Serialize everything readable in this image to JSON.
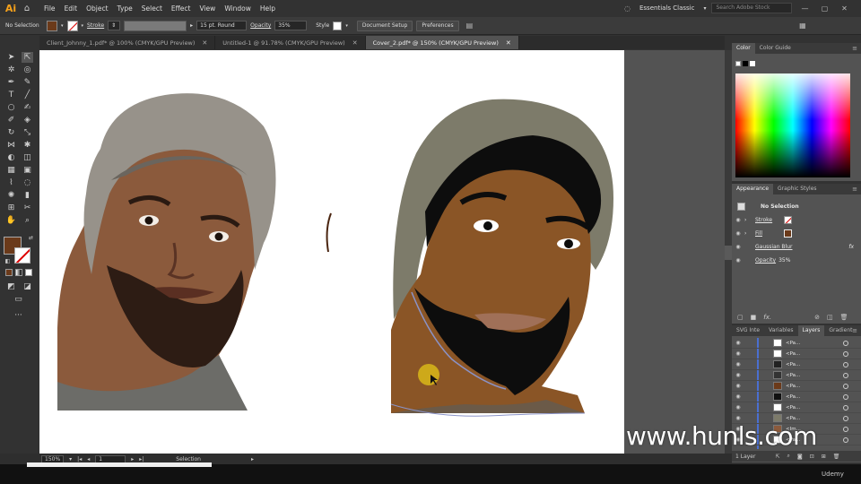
{
  "app": {
    "logo": "Ai",
    "home_icon": "home-icon"
  },
  "menu": [
    "File",
    "Edit",
    "Object",
    "Type",
    "Select",
    "Effect",
    "View",
    "Window",
    "Help"
  ],
  "workspace": "Essentials Classic",
  "search_placeholder": "Search Adobe Stock",
  "control": {
    "selection": "No Selection",
    "stroke_label": "Stroke",
    "brush": "15 pt. Round",
    "opacity_label": "Opacity",
    "opacity_value": "35%",
    "style_label": "Style",
    "doc_setup": "Document Setup",
    "preferences": "Preferences"
  },
  "tabs": [
    {
      "label": "Client_Johnny_1.pdf* @ 100% (CMYK/GPU Preview)",
      "active": false
    },
    {
      "label": "Untitled-1 @ 91.78% (CMYK/GPU Preview)",
      "active": false
    },
    {
      "label": "Cover_2.pdf* @ 150% (CMYK/GPU Preview)",
      "active": true
    }
  ],
  "color_panel": {
    "tabs": [
      "Color",
      "Color Guide"
    ]
  },
  "appearance_panel": {
    "tabs": [
      "Appearance",
      "Graphic Styles"
    ],
    "title": "No Selection",
    "rows": [
      {
        "label": "Stroke"
      },
      {
        "label": "Fill"
      },
      {
        "label": "Gaussian Blur",
        "fx": "fx"
      },
      {
        "label": "Opacity",
        "value": "35%"
      }
    ],
    "footer_fx": "fx."
  },
  "layers_panel": {
    "tabs": [
      "SVG Inte",
      "Variables",
      "Layers",
      "Gradient"
    ],
    "items": [
      "<Pa...",
      "<Pa...",
      "<Pa...",
      "<Pa...",
      "<Pa...",
      "<Pa...",
      "<Pa...",
      "<Pa...",
      "<Im...",
      "<Pa..."
    ],
    "footer": "1 Layer"
  },
  "status": {
    "zoom": "150%",
    "artboard": "1",
    "tool": "Selection"
  },
  "watermark": "www.hunls.com",
  "udemy": "Udemy",
  "colors": {
    "fill": "#6b3a1a",
    "accent": "#f7a21b",
    "skin": "#8a5526",
    "hat": "#7d7b6a"
  }
}
